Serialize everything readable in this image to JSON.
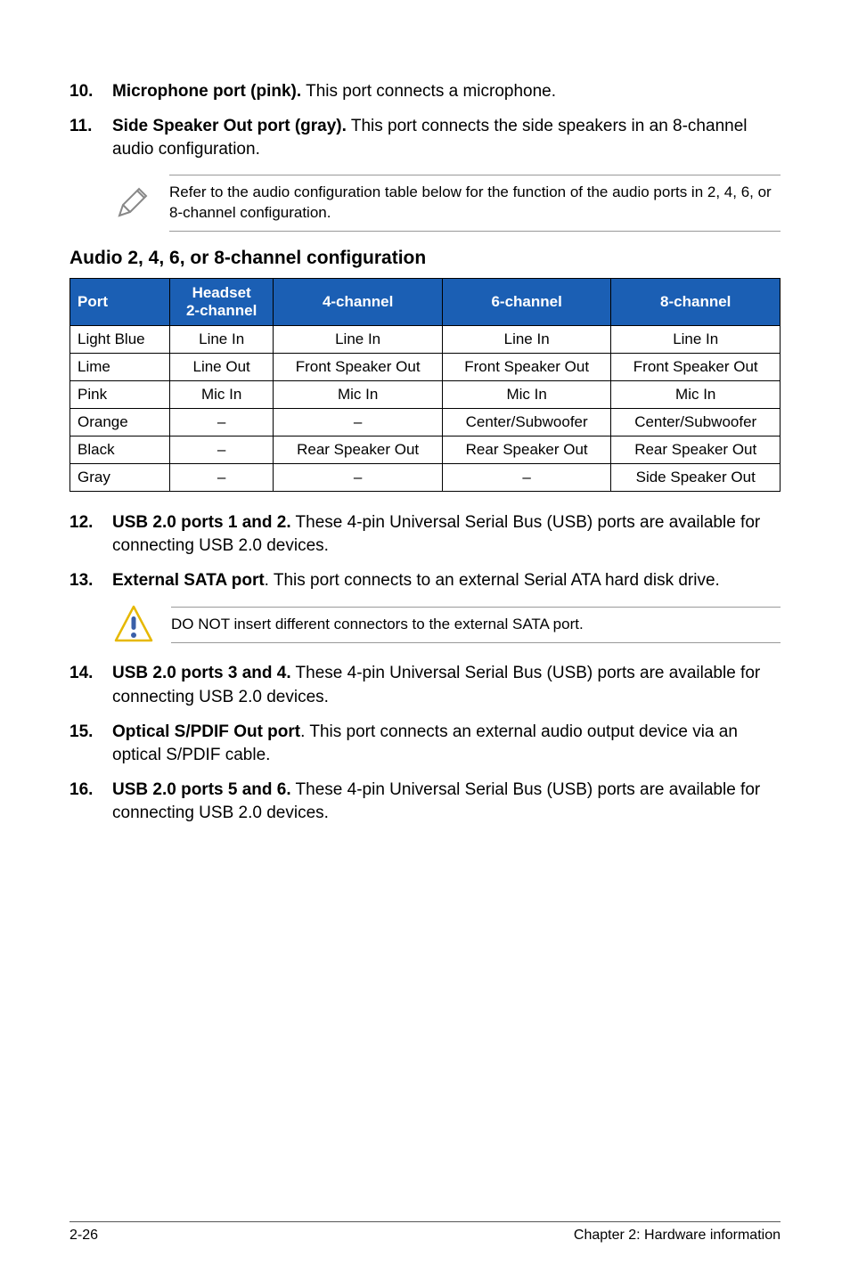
{
  "items": {
    "i10": {
      "num": "10.",
      "label": "Microphone port (pink).",
      "text": " This port connects a microphone."
    },
    "i11": {
      "num": "11.",
      "label": "Side Speaker Out port (gray).",
      "text": " This port connects the side speakers in an 8-channel audio configuration."
    },
    "i12": {
      "num": "12.",
      "label": "USB 2.0 ports 1 and 2.",
      "text": " These 4-pin Universal Serial Bus (USB) ports are available for connecting USB 2.0 devices."
    },
    "i13": {
      "num": "13.",
      "label": "External SATA port",
      "text": ". This port connects to an external Serial ATA hard disk drive."
    },
    "i14": {
      "num": "14.",
      "label": "USB 2.0 ports 3 and 4.",
      "text": " These 4-pin Universal Serial Bus (USB) ports are available for connecting USB 2.0 devices."
    },
    "i15": {
      "num": "15.",
      "label": "Optical S/PDIF Out port",
      "text": ". This port connects an external audio output device via an optical S/PDIF cable."
    },
    "i16": {
      "num": "16.",
      "label": "USB 2.0 ports 5 and 6.",
      "text": " These 4-pin Universal Serial Bus (USB) ports are available for connecting USB 2.0 devices."
    }
  },
  "note1": "Refer to the audio configuration table below for the function of the audio ports in 2, 4, 6, or 8-channel configuration.",
  "section_title": "Audio 2, 4, 6, or 8-channel configuration",
  "table": {
    "headers": {
      "c0": "Port",
      "c1_l1": "Headset",
      "c1_l2": "2-channel",
      "c2": "4-channel",
      "c3": "6-channel",
      "c4": "8-channel"
    },
    "rows": [
      {
        "c0": "Light Blue",
        "c1": "Line In",
        "c2": "Line In",
        "c3": "Line In",
        "c4": "Line In"
      },
      {
        "c0": "Lime",
        "c1": "Line Out",
        "c2": "Front Speaker Out",
        "c3": "Front Speaker Out",
        "c4": "Front Speaker Out"
      },
      {
        "c0": "Pink",
        "c1": "Mic In",
        "c2": "Mic In",
        "c3": "Mic In",
        "c4": "Mic In"
      },
      {
        "c0": "Orange",
        "c1": "–",
        "c2": "–",
        "c3": "Center/Subwoofer",
        "c4": "Center/Subwoofer"
      },
      {
        "c0": "Black",
        "c1": "–",
        "c2": "Rear Speaker Out",
        "c3": "Rear Speaker Out",
        "c4": "Rear Speaker Out"
      },
      {
        "c0": "Gray",
        "c1": "–",
        "c2": "–",
        "c3": "–",
        "c4": "Side Speaker Out"
      }
    ]
  },
  "warn": "DO NOT insert different connectors to the external SATA port.",
  "footer": {
    "left": "2-26",
    "right": "Chapter 2: Hardware information"
  }
}
